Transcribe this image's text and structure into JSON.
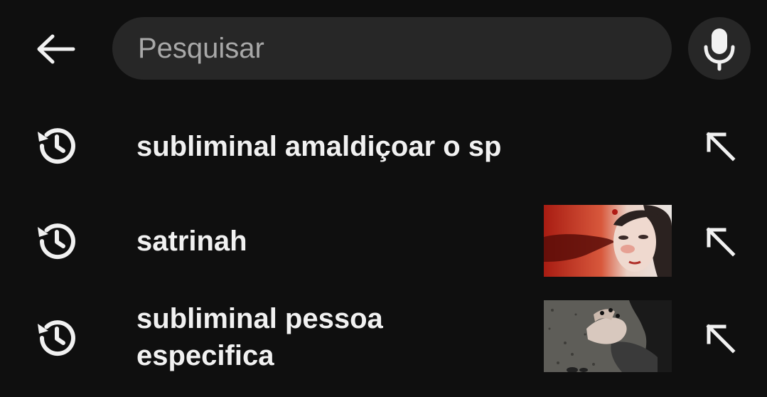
{
  "search": {
    "placeholder": "Pesquisar",
    "value": ""
  },
  "suggestions": [
    {
      "text": "subliminal amaldiçoar o sp",
      "icon": "history-icon",
      "action_icon": "north-west-arrow-icon",
      "has_thumbnail": false
    },
    {
      "text": "satrinah",
      "icon": "history-icon",
      "action_icon": "north-west-arrow-icon",
      "has_thumbnail": true
    },
    {
      "text": "subliminal pessoa\nespecifica",
      "icon": "history-icon",
      "action_icon": "north-west-arrow-icon",
      "has_thumbnail": true
    }
  ],
  "colors": {
    "background": "#0f0f0f",
    "search_field": "#272727",
    "text": "#f1f1f1",
    "placeholder": "#a8a8a8"
  }
}
